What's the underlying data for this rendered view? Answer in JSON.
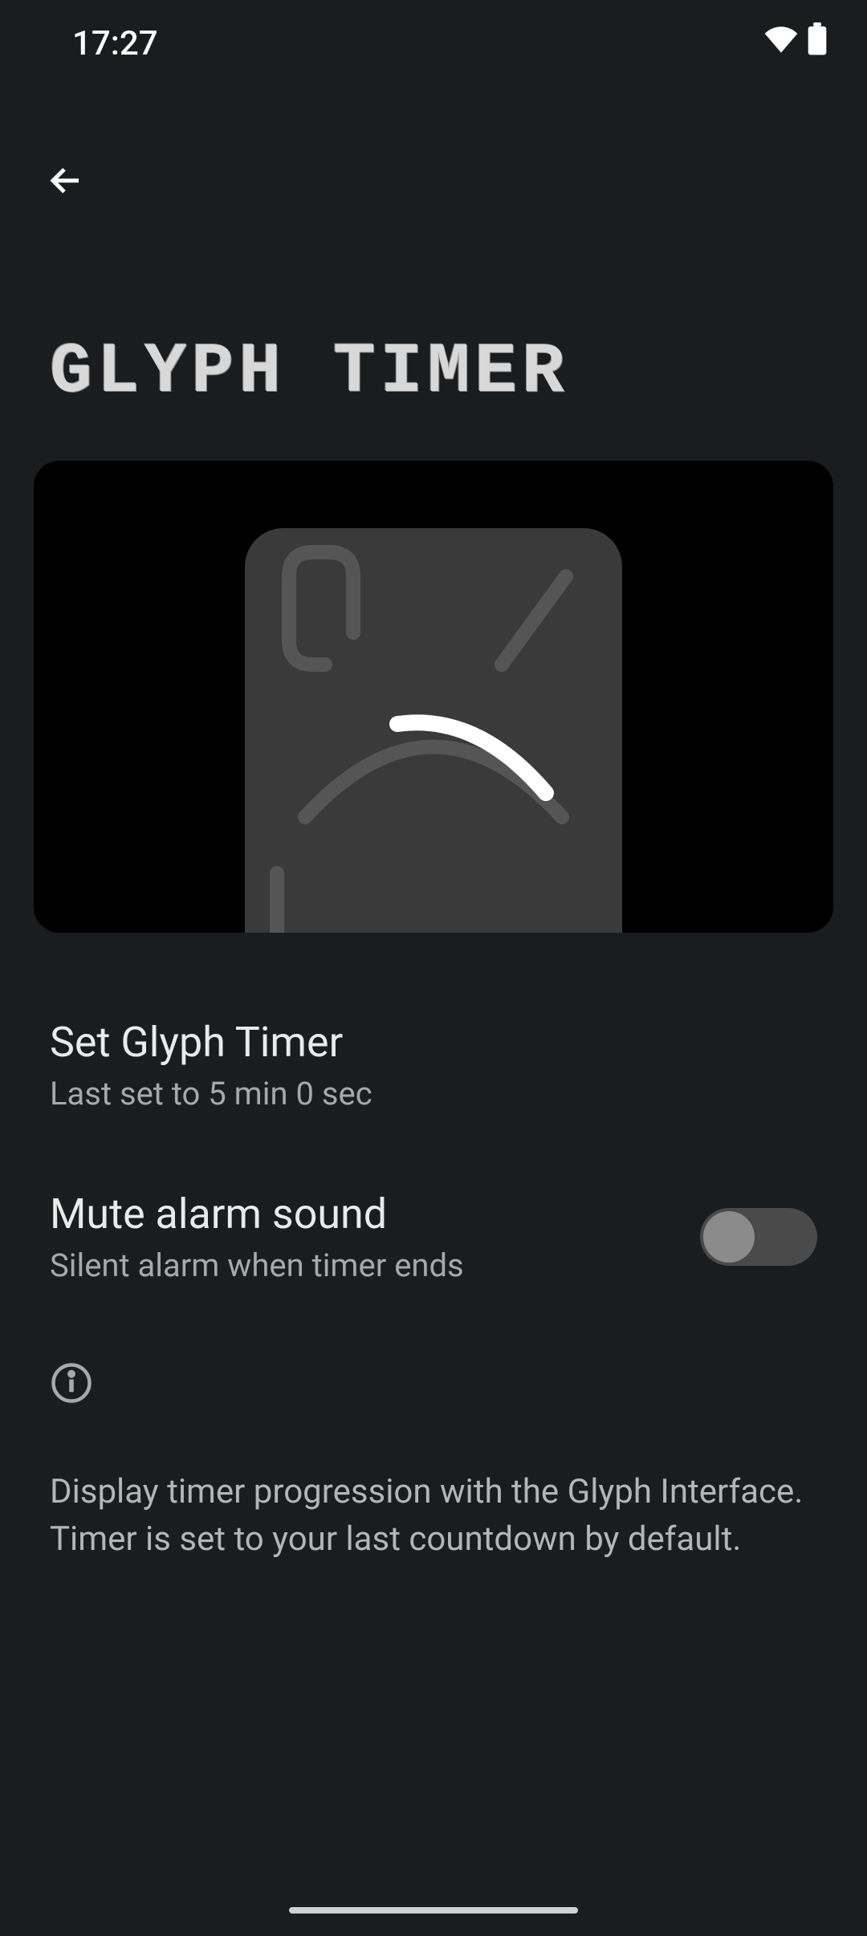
{
  "status_bar": {
    "time": "17:27"
  },
  "page": {
    "title": "GLYPH TIMER"
  },
  "settings": {
    "set_timer": {
      "title": "Set Glyph Timer",
      "subtitle": "Last set to 5 min 0 sec"
    },
    "mute_sound": {
      "title": "Mute alarm sound",
      "subtitle": "Silent alarm when timer ends",
      "enabled": false
    }
  },
  "info": {
    "text": "Display timer progression with the Glyph Interface. Timer is set to your last countdown by default."
  }
}
